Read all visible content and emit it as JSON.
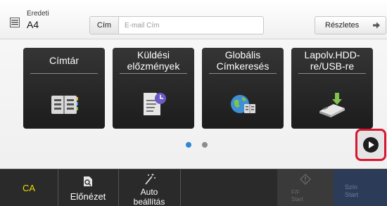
{
  "topbar": {
    "original_label": "Eredeti",
    "original_value": "A4",
    "address_button": "Cím",
    "address_placeholder": "E-mail Cím",
    "detail_button": "Részletes"
  },
  "tiles": [
    {
      "title": "Címtár",
      "icon": "address-book-icon"
    },
    {
      "title": "Küldési előzmények",
      "icon": "send-history-icon"
    },
    {
      "title": "Globális Címkeresés",
      "icon": "global-search-icon"
    },
    {
      "title": "Lapolv.HDD-re/USB-re",
      "icon": "usb-drive-icon"
    }
  ],
  "pager": {
    "pages": 2,
    "current": 1
  },
  "bottombar": {
    "ca": "CA",
    "preview": "Előnézet",
    "auto_line1": "Auto",
    "auto_line2": "beállítás",
    "bw_line1": "F/F",
    "bw_line2": "Start",
    "color_line1": "Szín",
    "color_line2": "Start"
  },
  "colors": {
    "accent_blue": "#2f86d6",
    "highlight_red": "#d8172f",
    "ca_yellow": "#f4d900"
  }
}
